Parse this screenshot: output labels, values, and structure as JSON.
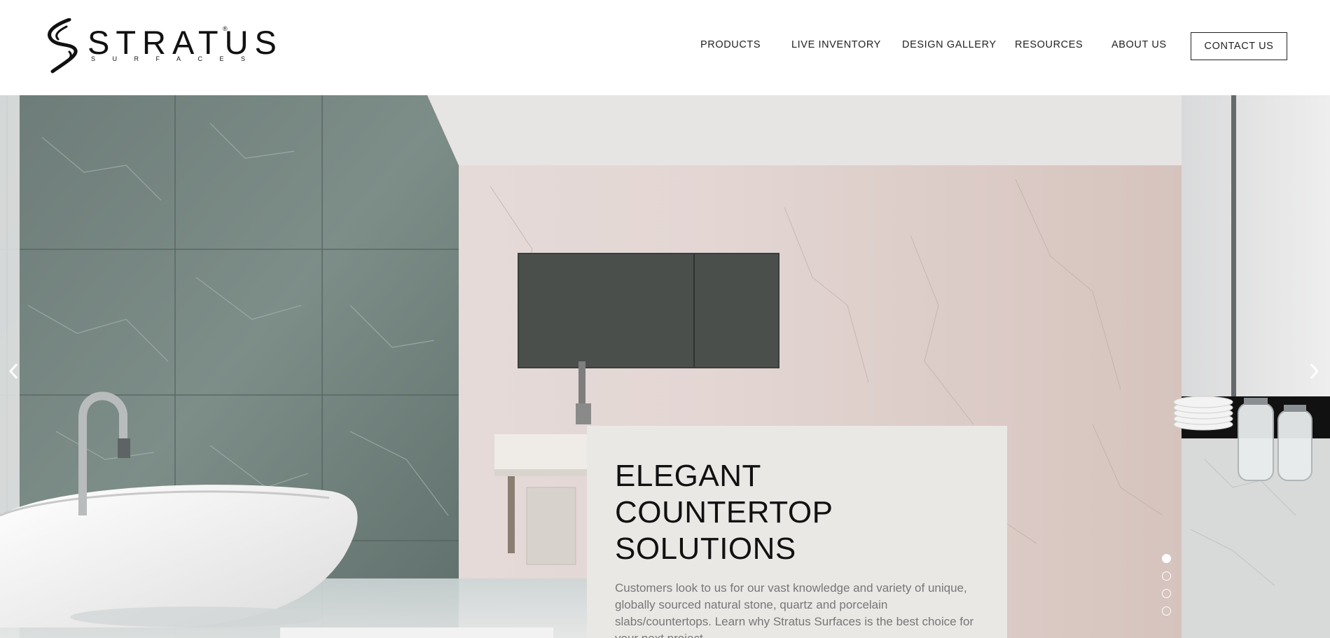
{
  "brand": {
    "name": "STRATUS",
    "tagline": "SURFACES",
    "reg": "®"
  },
  "nav": {
    "items": [
      {
        "label": "PRODUCTS"
      },
      {
        "label": "LIVE INVENTORY"
      },
      {
        "label": "DESIGN GALLERY"
      },
      {
        "label": "RESOURCES"
      },
      {
        "label": "ABOUT US"
      }
    ],
    "contact_label": "CONTACT US"
  },
  "hero": {
    "title": "ELEGANT COUNTERTOP SOLUTIONS",
    "text": "Customers look to us for our vast knowledge and variety of unique, globally sourced natural stone, quartz and porcelain slabs/countertops. Learn why Stratus Surfaces is the best choice for your next project.",
    "prev_icon": "chevron-left-icon",
    "next_icon": "chevron-right-icon",
    "slides_total": 4,
    "active_slide": 1
  },
  "colors": {
    "card_bg": "#eae8e5",
    "text_dark": "#111111",
    "text_muted": "#777777"
  }
}
